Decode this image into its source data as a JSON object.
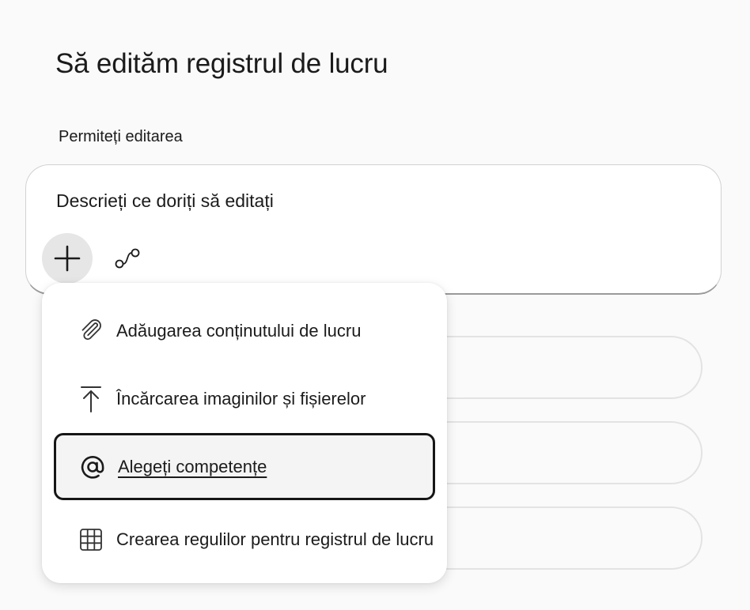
{
  "page": {
    "title": "Să edităm registrul de lucru"
  },
  "section": {
    "label": "Permiteți editarea"
  },
  "prompt": {
    "placeholder": "Descrieți ce doriți să editați",
    "add_icon": "plus-icon",
    "connect_icon": "connector-icon"
  },
  "menu": {
    "items": [
      {
        "label": "Adăugarea conținutului de lucru",
        "icon": "paperclip-icon"
      },
      {
        "label": "Încărcarea imaginilor și fișierelor",
        "icon": "upload-icon"
      },
      {
        "label": "Alegeți competențe",
        "icon": "at-icon",
        "focused": true
      },
      {
        "label": "Crearea regulilor pentru registrul de lucru",
        "icon": "table-grid-icon"
      }
    ]
  },
  "colors": {
    "background": "#fafafa",
    "surface": "#ffffff",
    "text": "#1b1b1b",
    "focus_border": "#161616"
  }
}
